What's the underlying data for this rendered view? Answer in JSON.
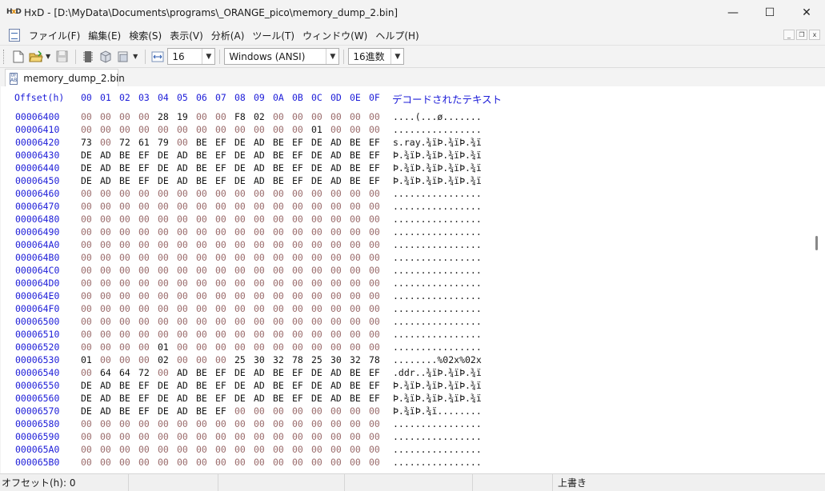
{
  "window": {
    "title": "HxD - [D:\\MyData\\Documents\\programs\\_ORANGE_pico\\memory_dump_2.bin]",
    "minimize": "—",
    "maximize": "☐",
    "close": "✕"
  },
  "menu": {
    "items": [
      "ファイル(F)",
      "編集(E)",
      "検索(S)",
      "表示(V)",
      "分析(A)",
      "ツール(T)",
      "ウィンドウ(W)",
      "ヘルプ(H)"
    ],
    "mdi_minimize": "_",
    "mdi_restore": "❐",
    "mdi_close": "x"
  },
  "toolbar": {
    "bytes_per_row": "16",
    "charset": "Windows (ANSI)",
    "offset_base": "16進数"
  },
  "tab": {
    "label": "memory_dump_2.bin"
  },
  "hex": {
    "header": {
      "offset": "Offset(h)",
      "columns": [
        "00",
        "01",
        "02",
        "03",
        "04",
        "05",
        "06",
        "07",
        "08",
        "09",
        "0A",
        "0B",
        "0C",
        "0D",
        "0E",
        "0F"
      ],
      "decoded": "デコードされたテキスト"
    },
    "rows": [
      {
        "offset": "00006400",
        "bytes": [
          "00",
          "00",
          "00",
          "00",
          "28",
          "19",
          "00",
          "00",
          "F8",
          "02",
          "00",
          "00",
          "00",
          "00",
          "00",
          "00"
        ],
        "text": "....(...ø......."
      },
      {
        "offset": "00006410",
        "bytes": [
          "00",
          "00",
          "00",
          "00",
          "00",
          "00",
          "00",
          "00",
          "00",
          "00",
          "00",
          "00",
          "01",
          "00",
          "00",
          "00"
        ],
        "text": "................"
      },
      {
        "offset": "00006420",
        "bytes": [
          "73",
          "00",
          "72",
          "61",
          "79",
          "00",
          "BE",
          "EF",
          "DE",
          "AD",
          "BE",
          "EF",
          "DE",
          "AD",
          "BE",
          "EF"
        ],
        "text": "s.ray.¾ïÞ.¾ïÞ.¾ï"
      },
      {
        "offset": "00006430",
        "bytes": [
          "DE",
          "AD",
          "BE",
          "EF",
          "DE",
          "AD",
          "BE",
          "EF",
          "DE",
          "AD",
          "BE",
          "EF",
          "DE",
          "AD",
          "BE",
          "EF"
        ],
        "text": "Þ.¾ïÞ.¾ïÞ.¾ïÞ.¾ï"
      },
      {
        "offset": "00006440",
        "bytes": [
          "DE",
          "AD",
          "BE",
          "EF",
          "DE",
          "AD",
          "BE",
          "EF",
          "DE",
          "AD",
          "BE",
          "EF",
          "DE",
          "AD",
          "BE",
          "EF"
        ],
        "text": "Þ.¾ïÞ.¾ïÞ.¾ïÞ.¾ï"
      },
      {
        "offset": "00006450",
        "bytes": [
          "DE",
          "AD",
          "BE",
          "EF",
          "DE",
          "AD",
          "BE",
          "EF",
          "DE",
          "AD",
          "BE",
          "EF",
          "DE",
          "AD",
          "BE",
          "EF"
        ],
        "text": "Þ.¾ïÞ.¾ïÞ.¾ïÞ.¾ï"
      },
      {
        "offset": "00006460",
        "bytes": [
          "00",
          "00",
          "00",
          "00",
          "00",
          "00",
          "00",
          "00",
          "00",
          "00",
          "00",
          "00",
          "00",
          "00",
          "00",
          "00"
        ],
        "text": "................"
      },
      {
        "offset": "00006470",
        "bytes": [
          "00",
          "00",
          "00",
          "00",
          "00",
          "00",
          "00",
          "00",
          "00",
          "00",
          "00",
          "00",
          "00",
          "00",
          "00",
          "00"
        ],
        "text": "................"
      },
      {
        "offset": "00006480",
        "bytes": [
          "00",
          "00",
          "00",
          "00",
          "00",
          "00",
          "00",
          "00",
          "00",
          "00",
          "00",
          "00",
          "00",
          "00",
          "00",
          "00"
        ],
        "text": "................"
      },
      {
        "offset": "00006490",
        "bytes": [
          "00",
          "00",
          "00",
          "00",
          "00",
          "00",
          "00",
          "00",
          "00",
          "00",
          "00",
          "00",
          "00",
          "00",
          "00",
          "00"
        ],
        "text": "................"
      },
      {
        "offset": "000064A0",
        "bytes": [
          "00",
          "00",
          "00",
          "00",
          "00",
          "00",
          "00",
          "00",
          "00",
          "00",
          "00",
          "00",
          "00",
          "00",
          "00",
          "00"
        ],
        "text": "................"
      },
      {
        "offset": "000064B0",
        "bytes": [
          "00",
          "00",
          "00",
          "00",
          "00",
          "00",
          "00",
          "00",
          "00",
          "00",
          "00",
          "00",
          "00",
          "00",
          "00",
          "00"
        ],
        "text": "................"
      },
      {
        "offset": "000064C0",
        "bytes": [
          "00",
          "00",
          "00",
          "00",
          "00",
          "00",
          "00",
          "00",
          "00",
          "00",
          "00",
          "00",
          "00",
          "00",
          "00",
          "00"
        ],
        "text": "................"
      },
      {
        "offset": "000064D0",
        "bytes": [
          "00",
          "00",
          "00",
          "00",
          "00",
          "00",
          "00",
          "00",
          "00",
          "00",
          "00",
          "00",
          "00",
          "00",
          "00",
          "00"
        ],
        "text": "................"
      },
      {
        "offset": "000064E0",
        "bytes": [
          "00",
          "00",
          "00",
          "00",
          "00",
          "00",
          "00",
          "00",
          "00",
          "00",
          "00",
          "00",
          "00",
          "00",
          "00",
          "00"
        ],
        "text": "................"
      },
      {
        "offset": "000064F0",
        "bytes": [
          "00",
          "00",
          "00",
          "00",
          "00",
          "00",
          "00",
          "00",
          "00",
          "00",
          "00",
          "00",
          "00",
          "00",
          "00",
          "00"
        ],
        "text": "................"
      },
      {
        "offset": "00006500",
        "bytes": [
          "00",
          "00",
          "00",
          "00",
          "00",
          "00",
          "00",
          "00",
          "00",
          "00",
          "00",
          "00",
          "00",
          "00",
          "00",
          "00"
        ],
        "text": "................"
      },
      {
        "offset": "00006510",
        "bytes": [
          "00",
          "00",
          "00",
          "00",
          "00",
          "00",
          "00",
          "00",
          "00",
          "00",
          "00",
          "00",
          "00",
          "00",
          "00",
          "00"
        ],
        "text": "................"
      },
      {
        "offset": "00006520",
        "bytes": [
          "00",
          "00",
          "00",
          "00",
          "01",
          "00",
          "00",
          "00",
          "00",
          "00",
          "00",
          "00",
          "00",
          "00",
          "00",
          "00"
        ],
        "text": "................"
      },
      {
        "offset": "00006530",
        "bytes": [
          "01",
          "00",
          "00",
          "00",
          "02",
          "00",
          "00",
          "00",
          "25",
          "30",
          "32",
          "78",
          "25",
          "30",
          "32",
          "78"
        ],
        "text": "........%02x%02x"
      },
      {
        "offset": "00006540",
        "bytes": [
          "00",
          "64",
          "64",
          "72",
          "00",
          "AD",
          "BE",
          "EF",
          "DE",
          "AD",
          "BE",
          "EF",
          "DE",
          "AD",
          "BE",
          "EF"
        ],
        "text": ".ddr..¾ïÞ.¾ïÞ.¾ï"
      },
      {
        "offset": "00006550",
        "bytes": [
          "DE",
          "AD",
          "BE",
          "EF",
          "DE",
          "AD",
          "BE",
          "EF",
          "DE",
          "AD",
          "BE",
          "EF",
          "DE",
          "AD",
          "BE",
          "EF"
        ],
        "text": "Þ.¾ïÞ.¾ïÞ.¾ïÞ.¾ï"
      },
      {
        "offset": "00006560",
        "bytes": [
          "DE",
          "AD",
          "BE",
          "EF",
          "DE",
          "AD",
          "BE",
          "EF",
          "DE",
          "AD",
          "BE",
          "EF",
          "DE",
          "AD",
          "BE",
          "EF"
        ],
        "text": "Þ.¾ïÞ.¾ïÞ.¾ïÞ.¾ï"
      },
      {
        "offset": "00006570",
        "bytes": [
          "DE",
          "AD",
          "BE",
          "EF",
          "DE",
          "AD",
          "BE",
          "EF",
          "00",
          "00",
          "00",
          "00",
          "00",
          "00",
          "00",
          "00"
        ],
        "text": "Þ.¾ïÞ.¾ï........"
      },
      {
        "offset": "00006580",
        "bytes": [
          "00",
          "00",
          "00",
          "00",
          "00",
          "00",
          "00",
          "00",
          "00",
          "00",
          "00",
          "00",
          "00",
          "00",
          "00",
          "00"
        ],
        "text": "................"
      },
      {
        "offset": "00006590",
        "bytes": [
          "00",
          "00",
          "00",
          "00",
          "00",
          "00",
          "00",
          "00",
          "00",
          "00",
          "00",
          "00",
          "00",
          "00",
          "00",
          "00"
        ],
        "text": "................"
      },
      {
        "offset": "000065A0",
        "bytes": [
          "00",
          "00",
          "00",
          "00",
          "00",
          "00",
          "00",
          "00",
          "00",
          "00",
          "00",
          "00",
          "00",
          "00",
          "00",
          "00"
        ],
        "text": "................"
      },
      {
        "offset": "000065B0",
        "bytes": [
          "00",
          "00",
          "00",
          "00",
          "00",
          "00",
          "00",
          "00",
          "00",
          "00",
          "00",
          "00",
          "00",
          "00",
          "00",
          "00"
        ],
        "text": "................"
      }
    ]
  },
  "status": {
    "offset": "オフセット(h): 0",
    "mode": "上書き"
  }
}
